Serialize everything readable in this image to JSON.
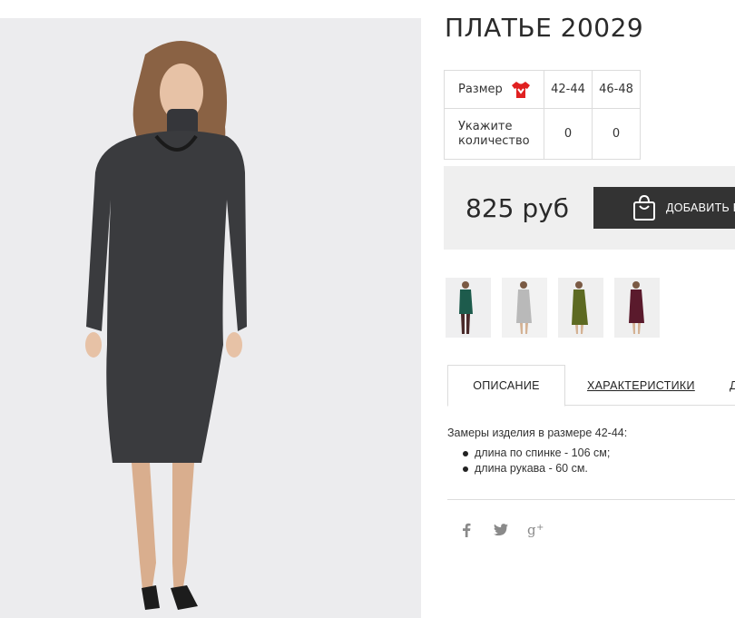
{
  "product": {
    "title": "ПЛАТЬЕ 20029",
    "price": "825 руб",
    "add_to_cart_label": "ДОБАВИТЬ В"
  },
  "size_table": {
    "size_label": "Размер",
    "sizes": [
      "42-44",
      "46-48"
    ],
    "quantity_label_line1": "Укажите",
    "quantity_label_line2": "количество",
    "quantities": [
      "0",
      "0"
    ]
  },
  "thumbnails": [
    {
      "color_name": "green",
      "color": "#1d5b4c"
    },
    {
      "color_name": "light-gray",
      "color": "#b9b9b9"
    },
    {
      "color_name": "olive",
      "color": "#5d6a22"
    },
    {
      "color_name": "burgundy",
      "color": "#5a1a2c"
    }
  ],
  "tabs": [
    {
      "label": "ОПИСАНИЕ",
      "active": true
    },
    {
      "label": "ХАРАКТЕРИСТИКИ",
      "active": false
    },
    {
      "label": "Д",
      "active": false
    }
  ],
  "description": {
    "heading": "Замеры изделия в размере 42-44:",
    "items": [
      "длина по спинке - 106 см;",
      "длина рукава - 60 см."
    ]
  },
  "share_icons": [
    "facebook-icon",
    "twitter-icon",
    "google-plus-icon"
  ],
  "colors": {
    "dress": "#3a3b3e",
    "button_bg": "#333333",
    "icon_accent": "#e02020",
    "price_box_bg": "#efefef"
  }
}
